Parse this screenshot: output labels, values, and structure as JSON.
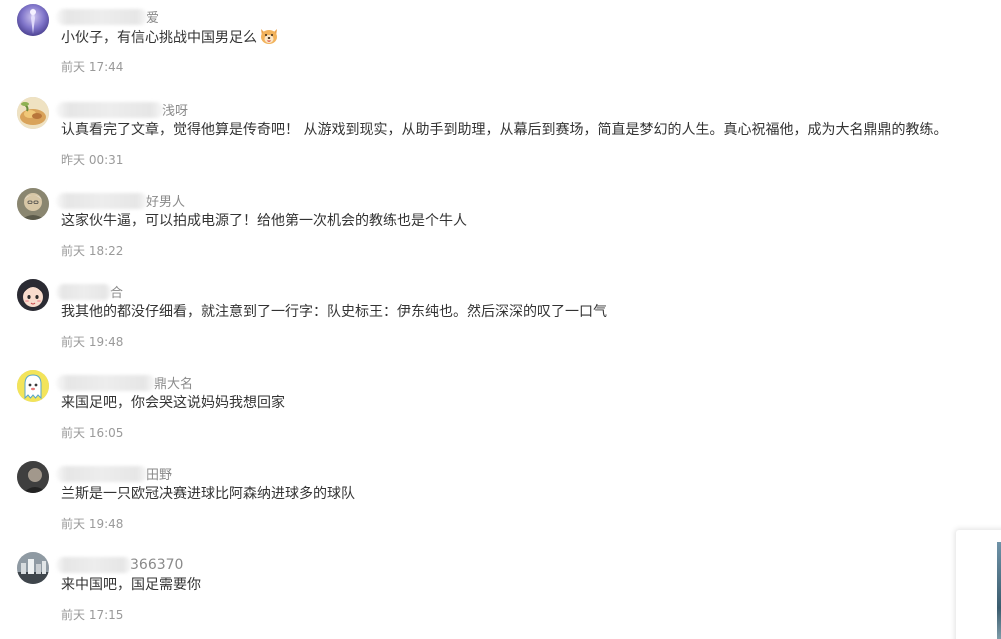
{
  "comments": [
    {
      "name_suffix": "爱",
      "text": "小伙子，有信心挑战中国男足么",
      "has_emoji": true,
      "emoji": "dog-face-emoji",
      "time": "前天 17:44",
      "avatar": "purple-figure-avatar"
    },
    {
      "name_suffix": "浅呀",
      "text": "认真看完了文章，觉得他算是传奇吧！ 从游戏到现实，从助手到助理，从幕后到赛场，简直是梦幻的人生。真心祝福他，成为大名鼎鼎的教练。",
      "time": "昨天 00:31",
      "avatar": "food-bowl-avatar"
    },
    {
      "name_suffix": "好男人",
      "text": "这家伙牛逼，可以拍成电源了！给他第一次机会的教练也是个牛人",
      "time": "前天 18:22",
      "avatar": "old-man-avatar"
    },
    {
      "name_suffix": "合",
      "text": "我其他的都没仔细看，就注意到了一行字：队史标王：伊东纯也。然后深深的叹了一口气",
      "time": "前天 19:48",
      "avatar": "cartoon-girl-avatar"
    },
    {
      "name_suffix": "鼎大名",
      "text": "来国足吧，你会哭这说妈妈我想回家",
      "time": "前天 16:05",
      "avatar": "ghost-avatar"
    },
    {
      "name_suffix": "田野",
      "text": "兰斯是一只欧冠决赛进球比阿森纳进球多的球队",
      "time": "前天 19:48",
      "avatar": "dark-portrait-avatar"
    },
    {
      "name_suffix": "366370",
      "text": "来中国吧，国足需要你",
      "time": "前天 17:15",
      "avatar": "city-photo-avatar"
    }
  ],
  "side_widget": {
    "icon": "floating-thumbnail"
  }
}
